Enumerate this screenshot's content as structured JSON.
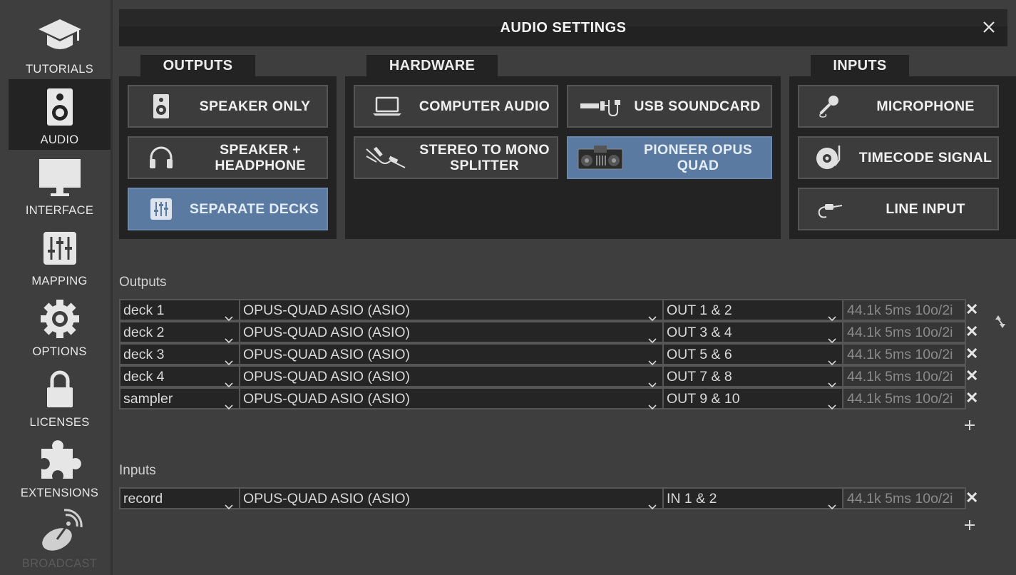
{
  "sidebar": {
    "items": [
      {
        "label": "TUTORIALS",
        "icon": "graduation-cap-icon"
      },
      {
        "label": "AUDIO",
        "icon": "speaker-icon",
        "active": true
      },
      {
        "label": "INTERFACE",
        "icon": "monitor-icon"
      },
      {
        "label": "MAPPING",
        "icon": "mixer-sliders-icon"
      },
      {
        "label": "OPTIONS",
        "icon": "gear-icon"
      },
      {
        "label": "LICENSES",
        "icon": "lock-icon"
      },
      {
        "label": "EXTENSIONS",
        "icon": "puzzle-icon"
      },
      {
        "label": "BROADCAST",
        "icon": "satellite-dish-icon"
      }
    ]
  },
  "dialog": {
    "title": "AUDIO SETTINGS",
    "close_icon": "close-icon"
  },
  "outputs_tab": {
    "label": "OUTPUTS",
    "buttons": [
      {
        "label": "SPEAKER ONLY",
        "icon": "speaker-icon"
      },
      {
        "label": "SPEAKER + HEADPHONE",
        "icon": "headphone-icon"
      },
      {
        "label": "SEPARATE DECKS",
        "icon": "mixer-icon",
        "selected": true
      }
    ]
  },
  "hardware_tab": {
    "label": "HARDWARE",
    "buttons": [
      {
        "label": "COMPUTER AUDIO",
        "icon": "laptop-icon"
      },
      {
        "label": "USB SOUNDCARD",
        "icon": "usb-soundcard-icon"
      },
      {
        "label": "STEREO TO MONO SPLITTER",
        "icon": "splitter-cable-icon"
      },
      {
        "label": "PIONEER OPUS QUAD",
        "icon": "controller-icon",
        "selected": true
      }
    ]
  },
  "inputs_tab": {
    "label": "INPUTS",
    "buttons": [
      {
        "label": "MICROPHONE",
        "icon": "microphone-icon"
      },
      {
        "label": "TIMECODE SIGNAL",
        "icon": "turntable-icon"
      },
      {
        "label": "LINE INPUT",
        "icon": "jack-cable-icon"
      }
    ]
  },
  "outputs_section": {
    "label": "Outputs",
    "rows": [
      {
        "channel": "deck 1",
        "device": "OPUS-QUAD ASIO (ASIO)",
        "port": "OUT 1 & 2",
        "info": "44.1k 5ms 10o/2i"
      },
      {
        "channel": "deck 2",
        "device": "OPUS-QUAD ASIO (ASIO)",
        "port": "OUT 3 & 4",
        "info": "44.1k 5ms 10o/2i"
      },
      {
        "channel": "deck 3",
        "device": "OPUS-QUAD ASIO (ASIO)",
        "port": "OUT 5 & 6",
        "info": "44.1k 5ms 10o/2i"
      },
      {
        "channel": "deck 4",
        "device": "OPUS-QUAD ASIO (ASIO)",
        "port": "OUT 7 & 8",
        "info": "44.1k 5ms 10o/2i"
      },
      {
        "channel": "sampler",
        "device": "OPUS-QUAD ASIO (ASIO)",
        "port": "OUT 9 & 10",
        "info": "44.1k 5ms 10o/2i"
      }
    ]
  },
  "inputs_section": {
    "label": "Inputs",
    "rows": [
      {
        "channel": "record",
        "device": "OPUS-QUAD ASIO (ASIO)",
        "port": "IN 1 & 2",
        "info": "44.1k 5ms 10o/2i"
      }
    ]
  },
  "remove_symbol": "✕",
  "colors": {
    "background": "#3e3e3e",
    "panel": "#232323",
    "selected": "#5b7aa1",
    "active_nav": "#232323"
  }
}
